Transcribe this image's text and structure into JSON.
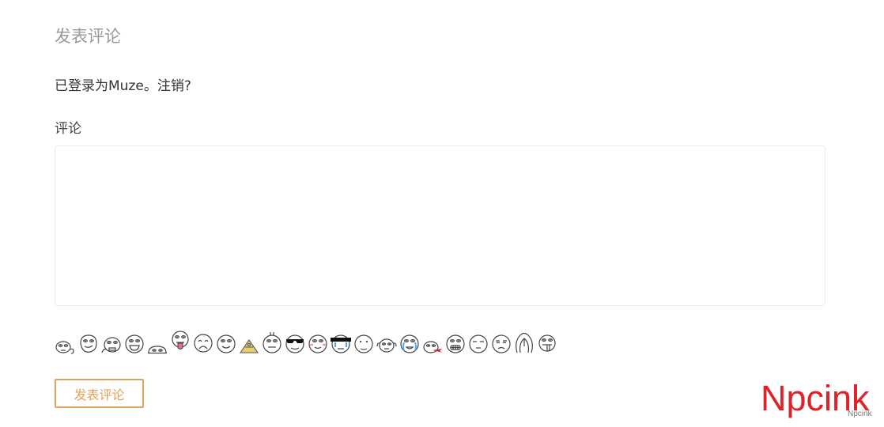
{
  "comment_form": {
    "title": "发表评论",
    "logged_in_prefix": "已登录为",
    "username": "Muze",
    "separator": "。",
    "logout_label": "注销?",
    "comment_label": "评论",
    "comment_value": "",
    "submit_label": "发表评论"
  },
  "emojis": [
    "emoji-1-icon",
    "emoji-2-icon",
    "emoji-3-icon",
    "emoji-4-icon",
    "emoji-5-icon",
    "emoji-6-icon",
    "emoji-7-icon",
    "emoji-8-icon",
    "emoji-9-icon",
    "emoji-10-icon",
    "emoji-11-icon",
    "emoji-12-icon",
    "emoji-13-icon",
    "emoji-14-icon",
    "emoji-15-icon",
    "emoji-16-icon",
    "emoji-17-icon",
    "emoji-18-icon",
    "emoji-19-icon",
    "emoji-20-icon",
    "emoji-21-icon",
    "emoji-22-icon",
    "emoji-23-icon"
  ],
  "watermark": {
    "big": "Npcink",
    "small": "Npcink",
    "color": "#e02127"
  },
  "colors": {
    "accent": "#e0a25c",
    "title": "#9a9a9a",
    "border": "#ececec"
  }
}
